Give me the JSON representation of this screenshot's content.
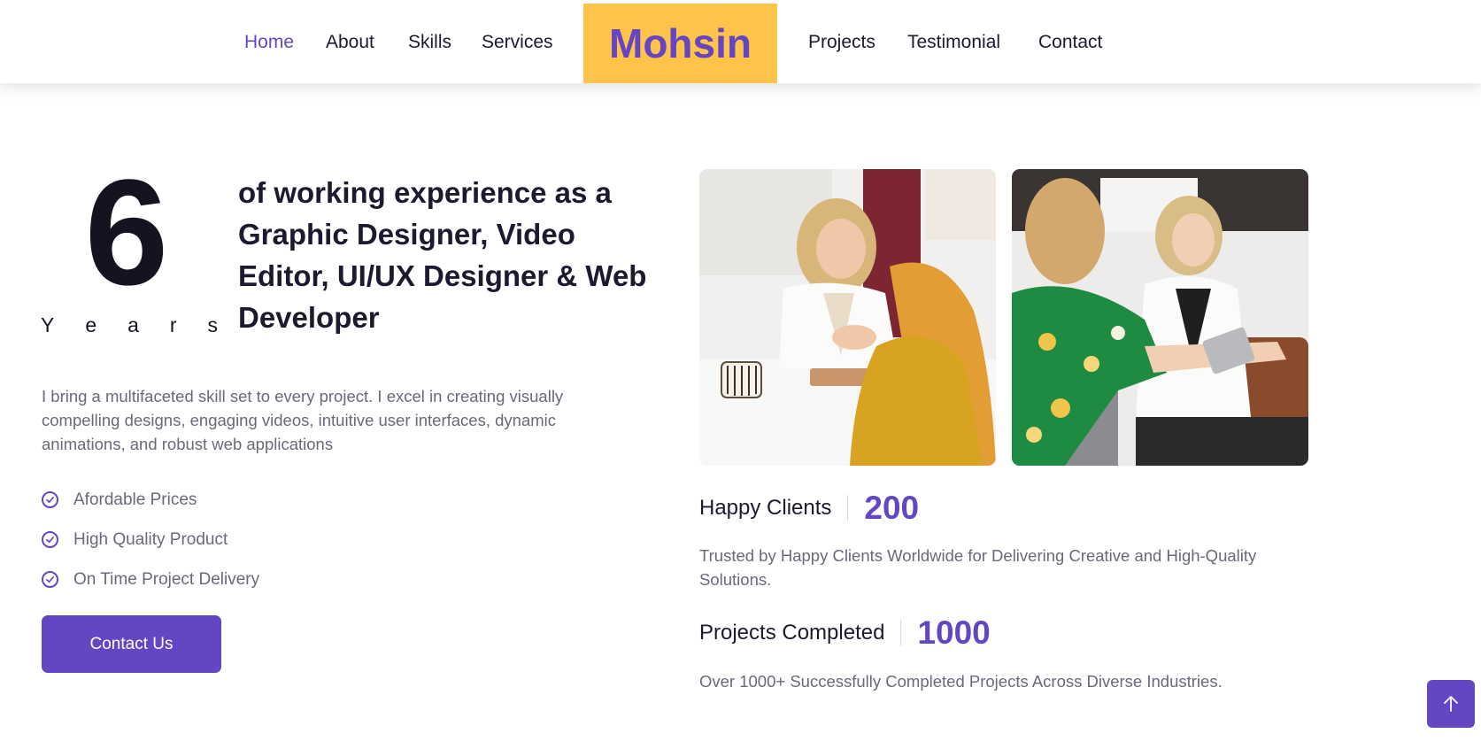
{
  "nav": {
    "left": [
      {
        "label": "Home",
        "active": true
      },
      {
        "label": "About"
      },
      {
        "label": "Skills"
      },
      {
        "label": "Services"
      }
    ],
    "brand": "Mohsin",
    "right": [
      {
        "label": "Projects"
      },
      {
        "label": "Testimonial"
      },
      {
        "label": "Contact"
      }
    ]
  },
  "hero": {
    "years_number": "6",
    "years_word": [
      "Y",
      "e",
      "a",
      "r",
      "s"
    ],
    "headline": "of working experience as a Graphic Designer, Video Editor, UI/UX Designer & Web Developer",
    "intro": "I bring a multifaceted skill set to every project. I excel in creating visually compelling designs, engaging videos, intuitive user interfaces, dynamic animations, and robust web applications",
    "features": [
      "Afordable Prices",
      "High Quality Product",
      "On Time Project Delivery"
    ],
    "contact_button": "Contact Us"
  },
  "stats": {
    "clients": {
      "label": "Happy Clients",
      "value": "200",
      "description": "Trusted by Happy Clients Worldwide for Delivering Creative and High-Quality Solutions."
    },
    "projects": {
      "label": "Projects Completed",
      "value": "1000",
      "description": "Over 1000+ Successfully Completed Projects Across Diverse Industries."
    }
  },
  "icons": {
    "feature": "check-circle-icon",
    "scroll_top": "arrow-up-icon"
  },
  "colors": {
    "accent": "#6445c3",
    "brand_bg": "#ffc349",
    "text_dark": "#1c1a2e",
    "text_muted": "#6b6878"
  }
}
